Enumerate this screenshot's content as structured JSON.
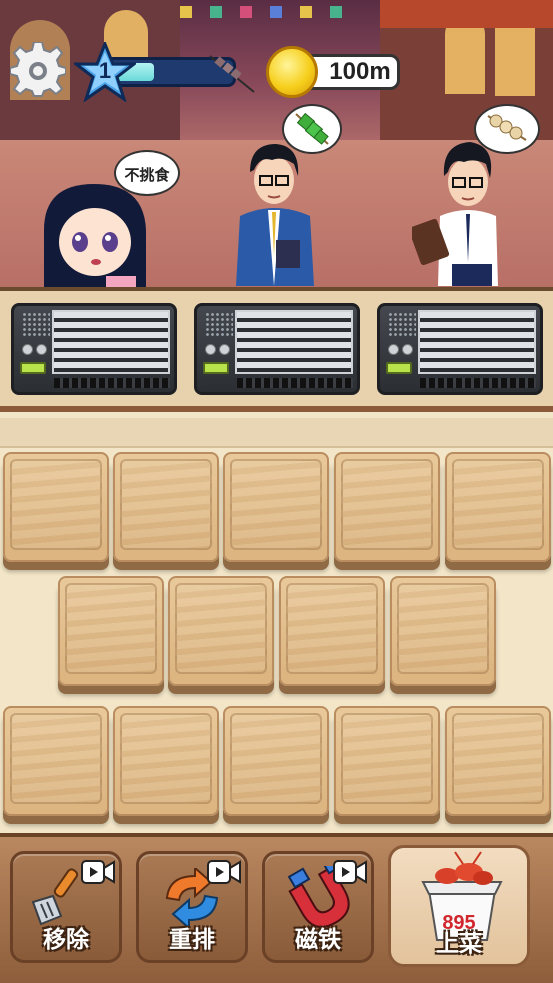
{
  "hud": {
    "level": "1",
    "xp_fraction": 0.35,
    "coins": "100m"
  },
  "customers": [
    {
      "name": "girl-customer",
      "bubble": "不挑食"
    },
    {
      "name": "businessman-customer",
      "bubble_icon": "green-vegetable-skewer"
    },
    {
      "name": "schoolboy-customer",
      "bubble_icon": "meatball-skewer"
    }
  ],
  "grills": [
    {
      "id": 1
    },
    {
      "id": 2
    },
    {
      "id": 3
    }
  ],
  "board": {
    "rows": [
      5,
      4,
      5
    ]
  },
  "toolbar": {
    "remove_label": "移除",
    "shuffle_label": "重排",
    "magnet_label": "磁铁",
    "serve_label": "上菜",
    "serve_count": "895"
  },
  "colors": {
    "xp_fill": "#6ad9d8",
    "coin": "#f6cf1c",
    "serve_count": "#d2262d",
    "led": "#b8e34a"
  }
}
